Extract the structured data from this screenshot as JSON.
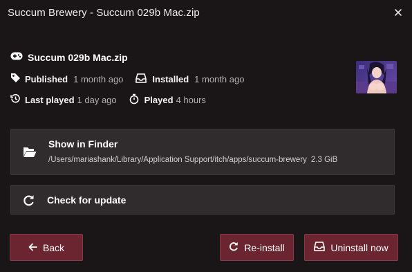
{
  "window": {
    "title": "Succum Brewery - Succum 029b Mac.zip"
  },
  "upload": {
    "name": "Succum 029b Mac.zip",
    "published_label": "Published",
    "published_value": "1 month ago",
    "installed_label": "Installed",
    "installed_value": "1 month ago",
    "last_played_label": "Last played",
    "last_played_value": "1 day ago",
    "played_label": "Played",
    "played_value": "4 hours"
  },
  "finder": {
    "title": "Show in Finder",
    "path": "/Users/mariashank/Library/Application Support/itch/apps/succum-brewery",
    "size": "2.3 GiB"
  },
  "update": {
    "label": "Check for update"
  },
  "buttons": {
    "back": "Back",
    "reinstall": "Re-install",
    "uninstall": "Uninstall now"
  },
  "icons": {
    "close": "close-icon",
    "gamepad": "gamepad-icon",
    "tag": "tag-icon",
    "installed": "inbox-icon",
    "history": "history-icon",
    "stopwatch": "stopwatch-icon",
    "folder": "folder-open-icon",
    "refresh": "refresh-icon",
    "arrow_left": "arrow-left-icon",
    "uninstall": "inbox-icon"
  },
  "colors": {
    "background": "#1a1516",
    "panel": "#302b2c",
    "button": "#6a2530",
    "button_border": "#8a3a45",
    "muted_text": "#b3b3b3"
  }
}
